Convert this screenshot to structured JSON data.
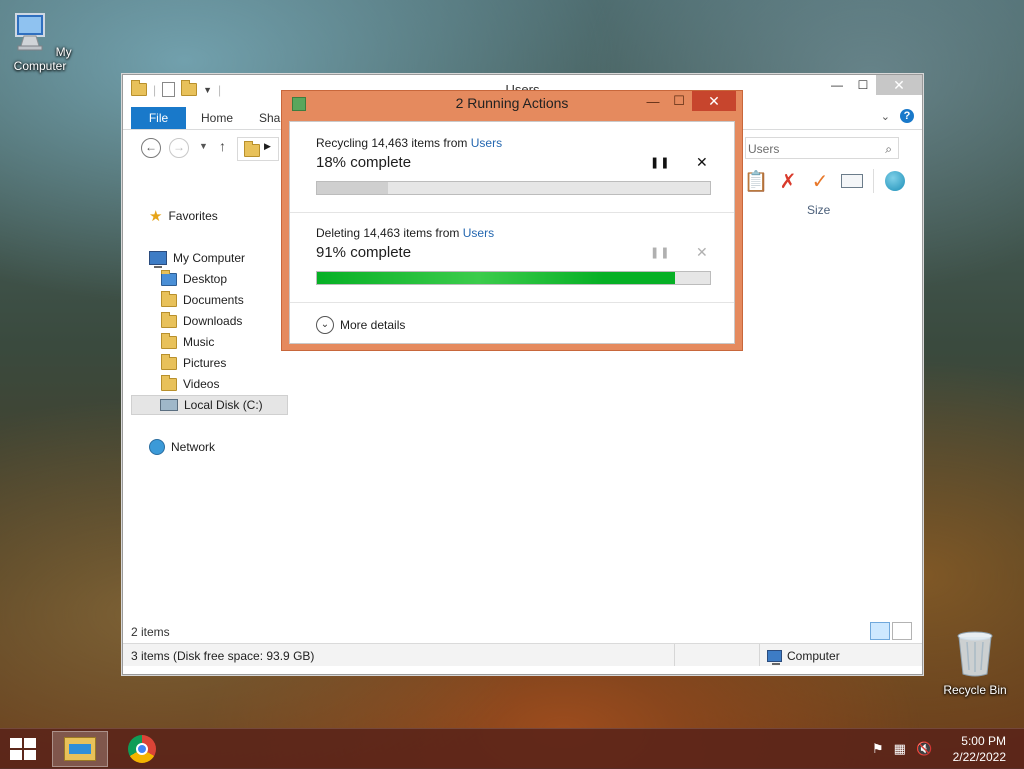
{
  "desktop": {
    "icons": [
      {
        "label": "My Computer",
        "icon": "computer-icon"
      },
      {
        "label": "Recycle Bin",
        "icon": "recycle-bin-icon"
      }
    ]
  },
  "explorer": {
    "title": "Users",
    "tabs": {
      "file": "File",
      "home": "Home",
      "share": "Shar"
    },
    "search_text": "Users",
    "column_header": "Size",
    "nav": {
      "favorites": "Favorites",
      "my_computer": "My Computer",
      "desktop": "Desktop",
      "documents": "Documents",
      "downloads": "Downloads",
      "music": "Music",
      "pictures": "Pictures",
      "videos": "Videos",
      "local_disk": "Local Disk (C:)",
      "network": "Network"
    },
    "status_items": "2 items",
    "status_bar_left": "3 items (Disk free space: 93.9 GB)",
    "status_bar_right": "Computer"
  },
  "dialog": {
    "title": "2 Running Actions",
    "operations": [
      {
        "action": "Recycling 14,463 items from ",
        "source": "Users",
        "progress_text": "18% complete",
        "progress": 18,
        "pause_enabled": true,
        "cancel_enabled": true
      },
      {
        "action": "Deleting 14,463 items from ",
        "source": "Users",
        "progress_text": "91% complete",
        "progress": 91,
        "pause_enabled": false,
        "cancel_enabled": false
      }
    ],
    "more_details": "More details",
    "accent": "#e58a5e",
    "progress_color": "#06b025"
  },
  "taskbar": {
    "apps": [
      {
        "name": "File Explorer",
        "icon": "folder-icon",
        "active": true
      },
      {
        "name": "Google Chrome",
        "icon": "chrome-icon",
        "active": false
      }
    ],
    "time": "5:00 PM",
    "date": "2/22/2022"
  }
}
